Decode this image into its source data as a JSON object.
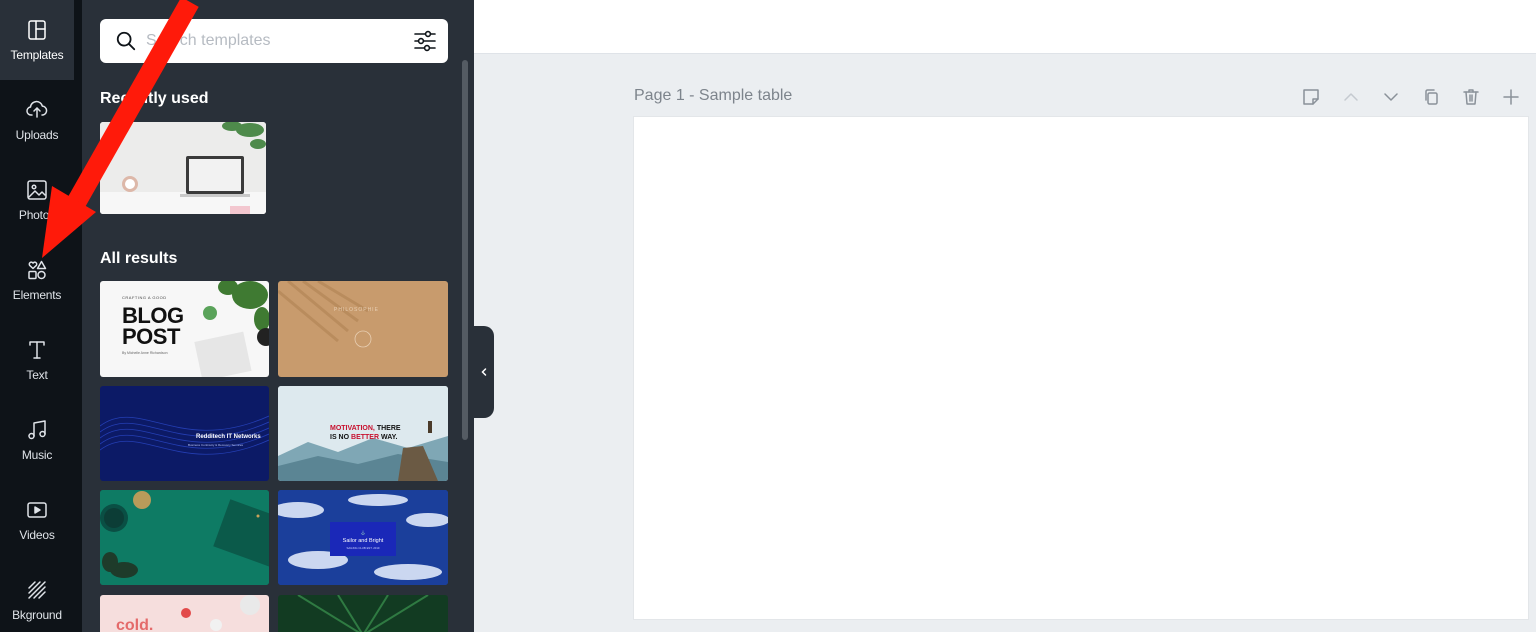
{
  "rail": {
    "items": [
      {
        "label": "Templates",
        "icon": "templates-icon",
        "active": true
      },
      {
        "label": "Uploads",
        "icon": "upload-cloud-icon"
      },
      {
        "label": "Photos",
        "icon": "photos-icon"
      },
      {
        "label": "Elements",
        "icon": "elements-icon"
      },
      {
        "label": "Text",
        "icon": "text-icon"
      },
      {
        "label": "Music",
        "icon": "music-icon"
      },
      {
        "label": "Videos",
        "icon": "videos-icon"
      },
      {
        "label": "Bkground",
        "icon": "background-icon"
      }
    ]
  },
  "panel": {
    "search": {
      "placeholder": "Search templates",
      "value": ""
    },
    "recently_used_title": "Recently used",
    "all_results_title": "All results",
    "templates": [
      {
        "kicker": "CRAFTING A GOOD",
        "title_1": "BLOG",
        "title_2": "POST",
        "byline": "By Michelle Anne Richardson"
      },
      {
        "text": "PHILOSOPHIE"
      },
      {
        "title": "Redditech IT Networks",
        "subtitle": "Business Continuity & Recovery Services"
      },
      {
        "line_1a": "MOTIVATION,",
        "line_1b": "THERE",
        "line_2a": "IS NO",
        "line_2b": "BETTER",
        "line_2c": "WAY."
      },
      {
        "text": ""
      },
      {
        "title": "Sailor and Bright",
        "subtitle": "SAILING CLUB EST. 2019"
      },
      {
        "text": "cold."
      },
      {
        "text": ""
      }
    ]
  },
  "page": {
    "title": "Page 1 - Sample table"
  },
  "colors": {
    "rail_bg": "#0e1318",
    "panel_bg": "#293039",
    "annotation_arrow": "#ff1a0a",
    "canvas_bg": "#ebeef1"
  }
}
